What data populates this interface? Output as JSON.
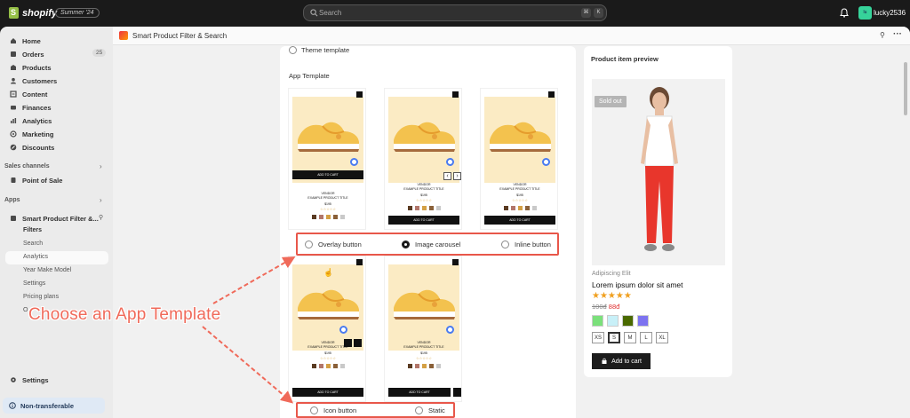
{
  "topbar": {
    "brand": "shopify",
    "edition": "Summer '24",
    "search_placeholder": "Search",
    "kbd1": "⌘",
    "kbd2": "K",
    "avatar_initials": "lu",
    "username": "lucky2536"
  },
  "sidebar": {
    "items": [
      {
        "label": "Home",
        "icon": "home-icon"
      },
      {
        "label": "Orders",
        "icon": "orders-icon"
      },
      {
        "label": "Products",
        "icon": "products-icon"
      },
      {
        "label": "Customers",
        "icon": "customers-icon"
      },
      {
        "label": "Content",
        "icon": "content-icon"
      },
      {
        "label": "Finances",
        "icon": "finances-icon"
      },
      {
        "label": "Analytics",
        "icon": "analytics-icon"
      },
      {
        "label": "Marketing",
        "icon": "marketing-icon"
      },
      {
        "label": "Discounts",
        "icon": "discounts-icon"
      }
    ],
    "orders_badge": "25",
    "sales_channels_label": "Sales channels",
    "point_of_sale": "Point of Sale",
    "apps_label": "Apps",
    "app_name": "Smart Product Filter &...",
    "app_subitems": [
      "Filters",
      "Search",
      "Analytics",
      "Year Make Model",
      "Settings",
      "Pricing plans",
      "O"
    ],
    "settings": "Settings",
    "non_transferable": "Non-transferable"
  },
  "appbar": {
    "title": "Smart Product Filter & Search"
  },
  "left_card": {
    "theme_template": "Theme template",
    "section_title": "App Template",
    "template_text": {
      "add_to_cart": "ADD TO CART",
      "vendor": "VENDOR",
      "product_title": "EXAMPLE PRODUCT TITLE",
      "price": "$195",
      "rating": "☆☆☆☆☆"
    },
    "options_row1": [
      {
        "label": "Overlay button",
        "selected": false
      },
      {
        "label": "Image carousel",
        "selected": true
      },
      {
        "label": "Inline button",
        "selected": false
      }
    ],
    "options_row2": [
      {
        "label": "Icon button",
        "selected": false
      },
      {
        "label": "Static",
        "selected": false
      }
    ]
  },
  "preview": {
    "title": "Product item preview",
    "sold_out": "Sold out",
    "vendor": "Adipiscing Elit",
    "product_title": "Lorem ipsum dolor sit amet",
    "stars": "★★★★★",
    "old_price": "100đ",
    "new_price": "88đ",
    "colors": [
      "#7be07b",
      "#c8f0f8",
      "#4a6a00",
      "#7d73f0"
    ],
    "sizes": [
      "XS",
      "S",
      "M",
      "L",
      "XL"
    ],
    "selected_size": "S",
    "add_to_cart": "Add to cart"
  },
  "annotation": {
    "text": "Choose an App Template",
    "color": "#f06a5a"
  }
}
